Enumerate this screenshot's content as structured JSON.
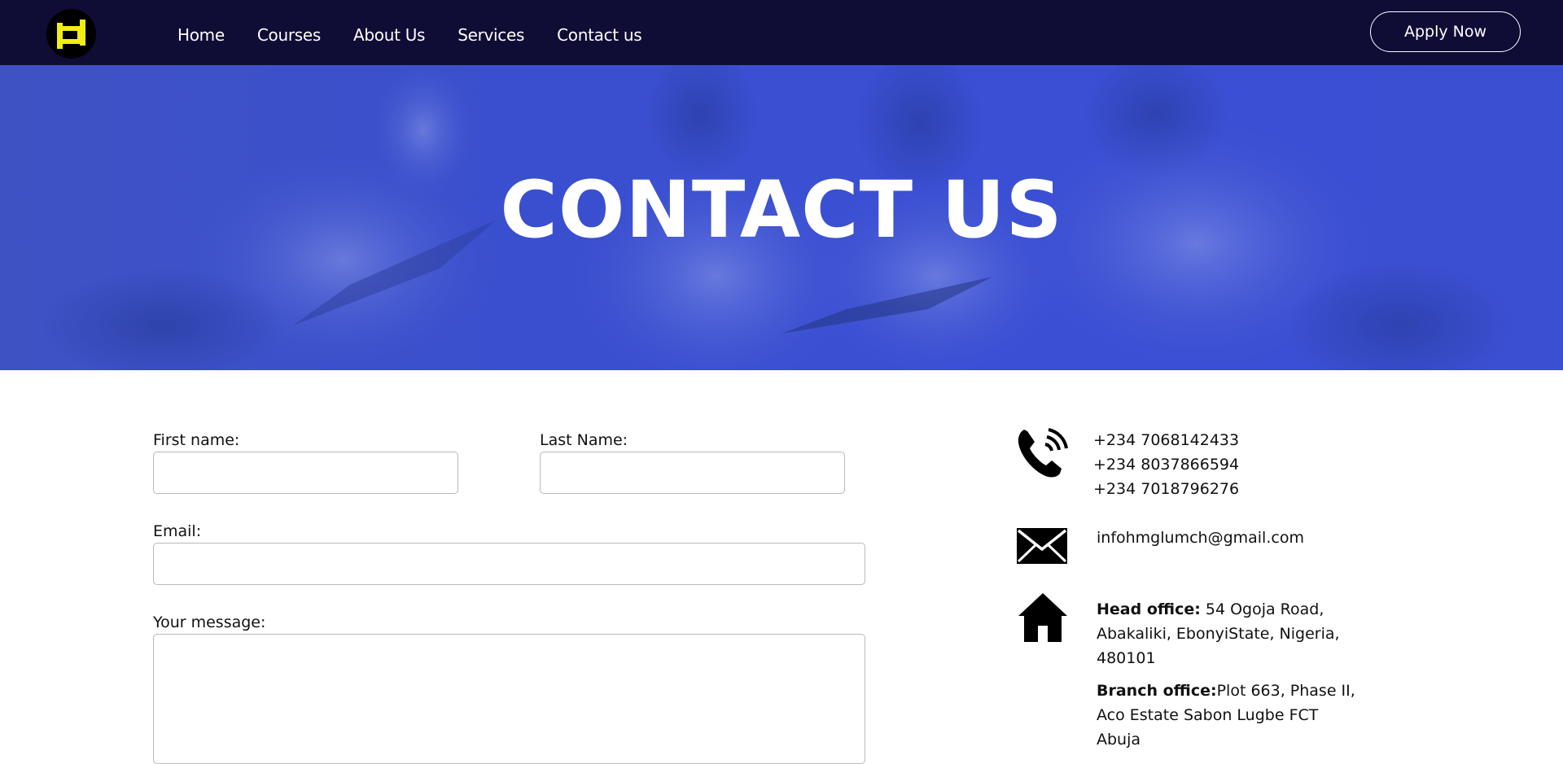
{
  "nav": {
    "logo": "logo-icon",
    "links": [
      "Home",
      "Courses",
      "About Us",
      "Services",
      "Contact us"
    ],
    "apply_label": "Apply Now"
  },
  "hero": {
    "title": "CONTACT US"
  },
  "form": {
    "first_name_label": "First name:",
    "last_name_label": "Last Name:",
    "email_label": "Email:",
    "message_label": "Your message:"
  },
  "contact": {
    "phone_icon": "phone-icon",
    "phones": [
      "+234 7068142433",
      "+234 8037866594",
      "+234 7018796276"
    ],
    "email_icon": "mail-icon",
    "email": "infohmglumch@gmail.com",
    "address_icon": "home-icon",
    "head_office_label": "Head office:",
    "head_office_line1": " 54 Ogoja Road,",
    "head_office_line2": "Abakaliki, EbonyiState, Nigeria,",
    "head_office_line3": "480101",
    "branch_office_label": "Branch office:",
    "branch_office_line1": "Plot 663, Phase II,",
    "branch_office_line2": "Aco Estate Sabon Lugbe FCT",
    "branch_office_line3": "Abuja"
  },
  "colors": {
    "nav_bg": "#0f0c36",
    "hero_overlay": "#3a4fd0",
    "logo_yellow": "#f2ee12"
  }
}
